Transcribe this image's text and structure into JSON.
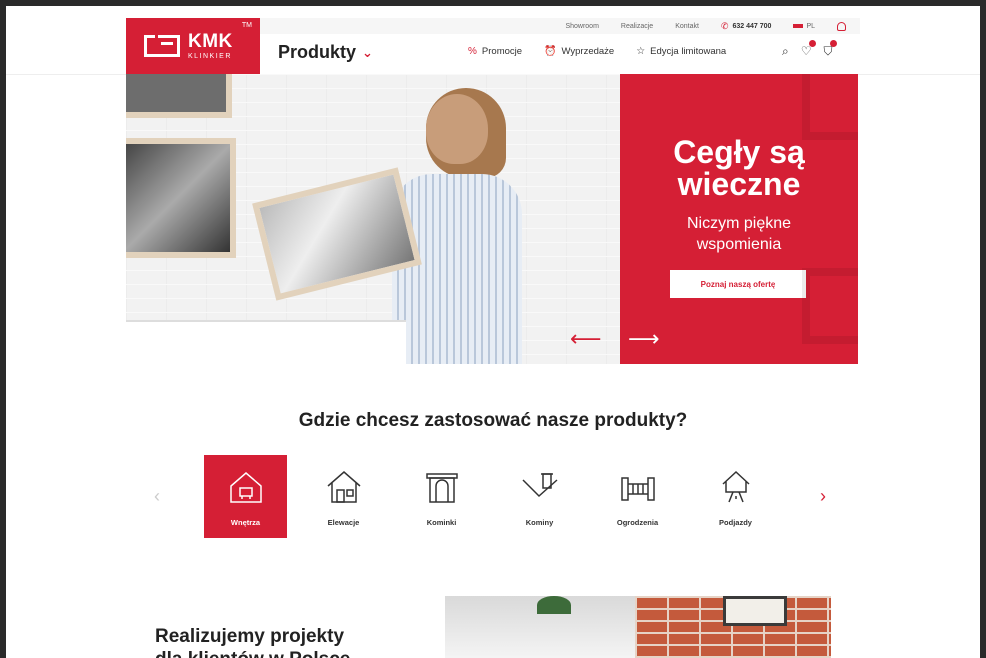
{
  "header": {
    "logo": {
      "brand": "KMK",
      "sub": "KLINKIER",
      "tm": "TM"
    },
    "topbar": {
      "links": [
        "Showroom",
        "Realizacje",
        "Kontakt"
      ],
      "phone": "632 447 700",
      "language": "PL"
    },
    "nav": {
      "produkty": "Produkty",
      "links": [
        {
          "label": "Promocje",
          "icon": "percent-icon"
        },
        {
          "label": "Wyprzedaże",
          "icon": "alarm-clock-icon"
        },
        {
          "label": "Edycja limitowana",
          "icon": "star-icon"
        }
      ]
    }
  },
  "hero": {
    "title_line1": "Cegły są",
    "title_line2": "wieczne",
    "subtitle_line1": "Niczym piękne",
    "subtitle_line2": "wspomienia",
    "cta": "Poznaj naszą ofertę",
    "prev_arrow": "⟵",
    "next_arrow": "⟶"
  },
  "applications": {
    "title": "Gdzie chcesz zastosować nasze produkty?",
    "items": [
      {
        "label": "Wnętrza",
        "icon": "interior-house-icon",
        "active": true
      },
      {
        "label": "Elewacje",
        "icon": "facade-house-icon",
        "active": false
      },
      {
        "label": "Kominki",
        "icon": "fireplace-icon",
        "active": false
      },
      {
        "label": "Kominy",
        "icon": "chimney-icon",
        "active": false
      },
      {
        "label": "Ogrodzenia",
        "icon": "fence-icon",
        "active": false
      },
      {
        "label": "Podjazdy",
        "icon": "driveway-icon",
        "active": false
      }
    ]
  },
  "projects": {
    "heading_line1": "Realizujemy projekty",
    "heading_line2": "dla klientów w Polsce"
  },
  "colors": {
    "accent": "#d51f35",
    "text": "#222222",
    "bg": "#ffffff"
  }
}
